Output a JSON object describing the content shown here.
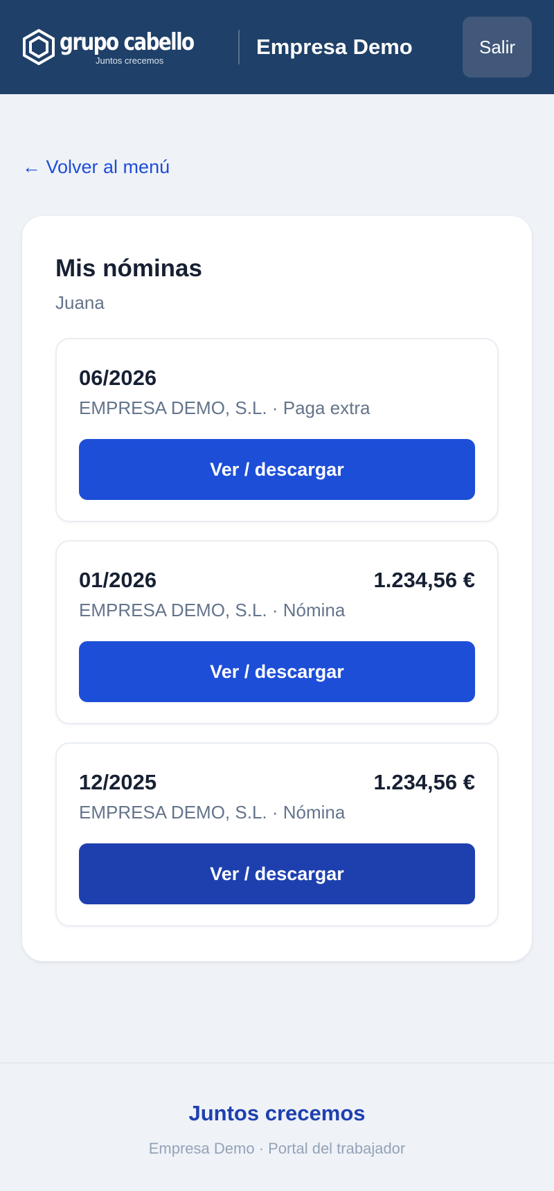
{
  "header": {
    "logo_name": "grupo cabello",
    "logo_tagline": "Juntos crecemos",
    "company": "Empresa Demo",
    "logout_label": "Salir"
  },
  "nav": {
    "back_label": "← Volver al menú"
  },
  "main": {
    "title": "Mis nóminas",
    "employee": "Juana",
    "payslips": [
      {
        "period": "06/2026",
        "amount": "",
        "description": "EMPRESA DEMO, S.L. · Paga extra",
        "button_label": "Ver / descargar"
      },
      {
        "period": "01/2026",
        "amount": "1.234,56 €",
        "description": "EMPRESA DEMO, S.L. · Nómina",
        "button_label": "Ver / descargar"
      },
      {
        "period": "12/2025",
        "amount": "1.234,56 €",
        "description": "EMPRESA DEMO, S.L. · Nómina",
        "button_label": "Ver / descargar"
      }
    ]
  },
  "footer": {
    "slogan": "Juntos crecemos",
    "subtitle": "Empresa Demo · Portal del trabajador"
  },
  "colors": {
    "header_bg": "#1f4068",
    "primary": "#1d4ed8",
    "primary_dark": "#1e40af",
    "page_bg": "#eff2f7"
  },
  "icons": {
    "logo": "hexagon-logo-icon"
  }
}
